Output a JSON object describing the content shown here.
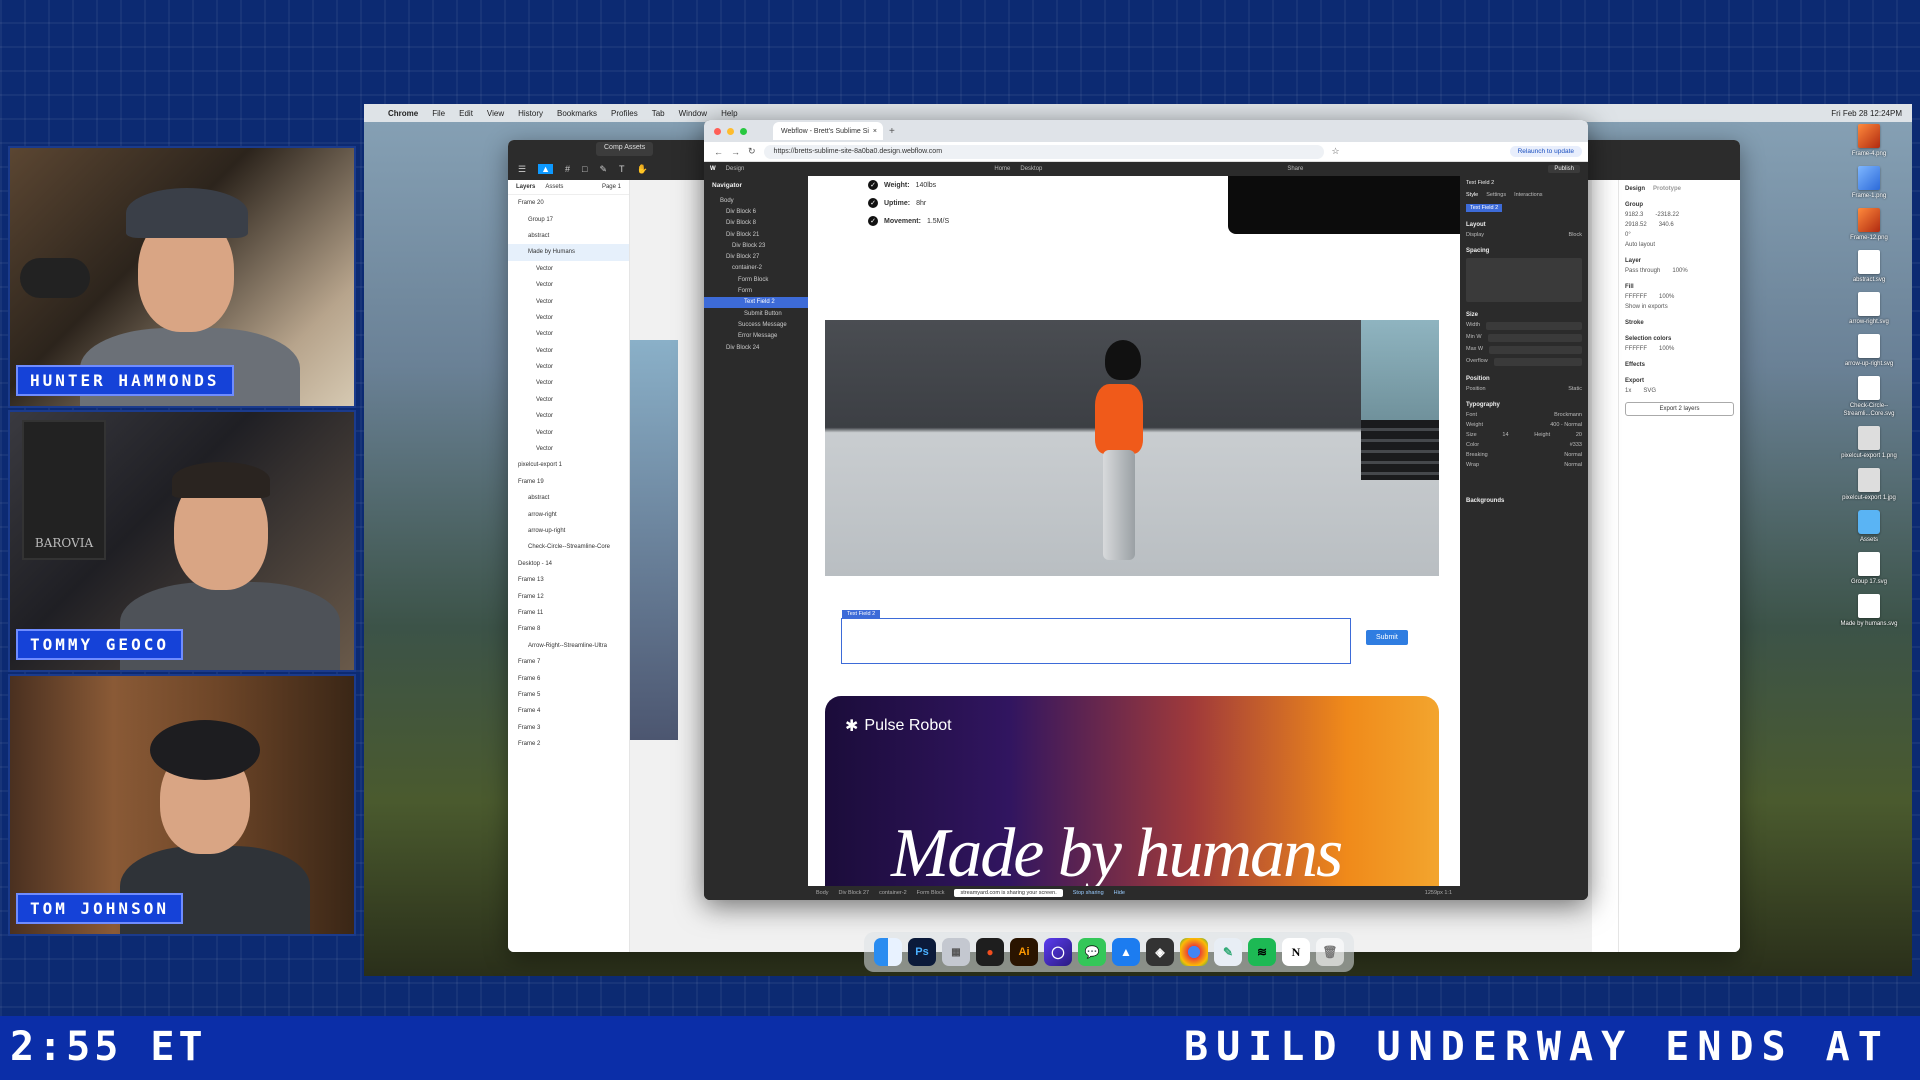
{
  "hosts": [
    {
      "name": "HUNTER HAMMONDS"
    },
    {
      "name": "TOMMY GEOCO"
    },
    {
      "name": "TOM JOHNSON"
    }
  ],
  "poster_text": "BAROVIA",
  "ticker": {
    "time": "2:55 ET",
    "scroll": "BUILD UNDERWAY ENDS AT"
  },
  "menubar": {
    "app": "Chrome",
    "items": [
      "File",
      "Edit",
      "View",
      "History",
      "Bookmarks",
      "Profiles",
      "Tab",
      "Window",
      "Help"
    ],
    "clock": "Fri Feb 28 12:24PM"
  },
  "figma": {
    "tab": "Comp Assets",
    "layers_tabs": [
      "Layers",
      "Assets",
      "Page 1"
    ],
    "layers": [
      {
        "label": "Frame 20",
        "indent": 0
      },
      {
        "label": "Group 17",
        "indent": 1
      },
      {
        "label": "abstract",
        "indent": 1
      },
      {
        "label": "Made by Humans",
        "indent": 1,
        "selected": true
      },
      {
        "label": "Vector",
        "indent": 2
      },
      {
        "label": "Vector",
        "indent": 2
      },
      {
        "label": "Vector",
        "indent": 2
      },
      {
        "label": "Vector",
        "indent": 2
      },
      {
        "label": "Vector",
        "indent": 2
      },
      {
        "label": "Vector",
        "indent": 2
      },
      {
        "label": "Vector",
        "indent": 2
      },
      {
        "label": "Vector",
        "indent": 2
      },
      {
        "label": "Vector",
        "indent": 2
      },
      {
        "label": "Vector",
        "indent": 2
      },
      {
        "label": "Vector",
        "indent": 2
      },
      {
        "label": "Vector",
        "indent": 2
      },
      {
        "label": "pixelcut-export 1",
        "indent": 0
      },
      {
        "label": "Frame 19",
        "indent": 0
      },
      {
        "label": "abstract",
        "indent": 1
      },
      {
        "label": "arrow-right",
        "indent": 1
      },
      {
        "label": "arrow-up-right",
        "indent": 1
      },
      {
        "label": "Check-Circle--Streamline-Core",
        "indent": 1
      },
      {
        "label": "Desktop - 14",
        "indent": 0
      },
      {
        "label": "Frame 13",
        "indent": 0
      },
      {
        "label": "Frame 12",
        "indent": 0
      },
      {
        "label": "Frame 11",
        "indent": 0
      },
      {
        "label": "Frame 8",
        "indent": 0
      },
      {
        "label": "Arrow-Right--Streamline-Ultra",
        "indent": 1
      },
      {
        "label": "Frame 7",
        "indent": 0
      },
      {
        "label": "Frame 6",
        "indent": 0
      },
      {
        "label": "Frame 5",
        "indent": 0
      },
      {
        "label": "Frame 4",
        "indent": 0
      },
      {
        "label": "Frame 3",
        "indent": 0
      },
      {
        "label": "Frame 2",
        "indent": 0
      }
    ],
    "right_tabs": [
      "Design",
      "Prototype"
    ],
    "right": {
      "group": "Group",
      "x": "9182.3",
      "y": "-2318.22",
      "w": "2918.52",
      "h": "340.6",
      "rotation": "0°",
      "auto_layout": "Auto layout",
      "layer": "Layer",
      "pass_through": "Pass through",
      "opacity": "100%",
      "fill": "Fill",
      "fill_hex": "FFFFFF",
      "fill_opacity": "100%",
      "show_in_exports": "Show in exports",
      "stroke": "Stroke",
      "selection_colors": "Selection colors",
      "selection_hex": "FFFFFF",
      "selection_opacity": "100%",
      "effects": "Effects",
      "export": "Export",
      "export_scale": "1x",
      "export_format": "SVG",
      "export_button": "Export 2 layers"
    }
  },
  "desktop_icons": [
    {
      "label": "Frame-4.png",
      "kind": "orange"
    },
    {
      "label": "Frame-1.png",
      "kind": "blue"
    },
    {
      "label": "Frame-12.png",
      "kind": "orange"
    },
    {
      "label": "abstract.svg",
      "kind": "white"
    },
    {
      "label": "arrow-right.svg",
      "kind": "white"
    },
    {
      "label": "arrow-up-right.svg",
      "kind": "white"
    },
    {
      "label": "Check-Circle--Streamli...Core.svg",
      "kind": "white"
    },
    {
      "label": "pixelcut-export 1.png",
      "kind": "img"
    },
    {
      "label": "pixelcut-export 1.jpg",
      "kind": "img"
    },
    {
      "label": "Assets",
      "kind": "folder"
    },
    {
      "label": "Group 17.svg",
      "kind": "white"
    },
    {
      "label": "Made by humans.svg",
      "kind": "white"
    }
  ],
  "chrome": {
    "tab_title": "Webflow - Brett's Sublime Si",
    "url": "https://bretts-sublime-site-8a0ba0.design.webflow.com",
    "relaunch": "Relaunch to update"
  },
  "webflow": {
    "mode": "Design",
    "page": "Home",
    "breakpoint": "Desktop",
    "share": "Share",
    "publish": "Publish",
    "navigator_title": "Navigator",
    "navigator": [
      {
        "label": "Body",
        "level": 0
      },
      {
        "label": "Div Block 6",
        "level": 1
      },
      {
        "label": "Div Block 8",
        "level": 1
      },
      {
        "label": "Div Block 21",
        "level": 1
      },
      {
        "label": "Div Block 23",
        "level": 2
      },
      {
        "label": "Div Block 27",
        "level": 1
      },
      {
        "label": "container-2",
        "level": 2
      },
      {
        "label": "Form Block",
        "level": 3
      },
      {
        "label": "Form",
        "level": 3
      },
      {
        "label": "Text Field 2",
        "level": 4,
        "selected": true
      },
      {
        "label": "Submit Button",
        "level": 4
      },
      {
        "label": "Success Message",
        "level": 3
      },
      {
        "label": "Error Message",
        "level": 3
      },
      {
        "label": "Div Block 24",
        "level": 1
      }
    ],
    "specs": [
      {
        "label": "Weight:",
        "value": "140lbs"
      },
      {
        "label": "Uptime:",
        "value": "8hr"
      },
      {
        "label": "Movement:",
        "value": "1.5M/S"
      }
    ],
    "form_tag": "Text Field 2",
    "submit": "Submit",
    "promo_logo": "Pulse Robot",
    "promo_headline": "Made by humans",
    "style_panel": {
      "selected": "Text Field 2",
      "tabs": [
        "Style",
        "Settings",
        "Interactions"
      ],
      "sections": [
        "Layout",
        "Spacing",
        "Size",
        "Position",
        "Typography",
        "Backgrounds"
      ],
      "display": "Block",
      "position": "Static",
      "font": "Brockmann",
      "weight": "400 - Normal",
      "size": "14",
      "height": "20",
      "color": "#333",
      "breaking": "Normal",
      "wrap": "Normal"
    },
    "status": {
      "crumbs": [
        "Body",
        "Div Block 27",
        "container-2",
        "Form Block"
      ],
      "sharing": "streamyard.com is sharing your screen.",
      "stop": "Stop sharing",
      "hide": "Hide",
      "zoom": "1259px 1:1"
    }
  },
  "dock": [
    "Finder",
    "Ps",
    "Launchpad",
    "Figma",
    "Ai",
    "Arc",
    "Messages",
    "Xcode",
    "Layers",
    "Chrome",
    "Preview",
    "Spotify",
    "Notion",
    "Trash"
  ]
}
